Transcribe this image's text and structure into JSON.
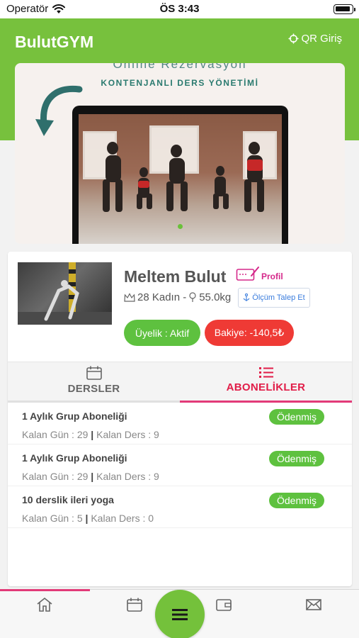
{
  "status_bar": {
    "carrier": "Operatör",
    "time": "ÖS 3:43"
  },
  "header": {
    "app_title": "BulutGYM",
    "qr_label": "QR Giriş"
  },
  "banner": {
    "title_partial": "Online Rezervasyon",
    "subtitle": "KONTENJANLI DERS YÖNETİMİ",
    "active_slide_color": "#6ac03a"
  },
  "profile": {
    "name": "Meltem Bulut",
    "profile_link": "Profil",
    "age_gender": "28 Kadın -",
    "weight": "55.0kg",
    "measure_button": "Ölçüm Talep Et",
    "membership_status": "Üyelik : Aktif",
    "balance": "Bakiye: -140,5₺"
  },
  "tabs": [
    {
      "label": "DERSLER",
      "icon": "calendar-icon",
      "active": false
    },
    {
      "label": "ABONELİKLER",
      "icon": "list-icon",
      "active": true
    }
  ],
  "subscriptions": [
    {
      "title": "1 Aylık Grup Aboneliği",
      "days_label": "Kalan Gün : 29",
      "sep": "|",
      "lessons_label": "Kalan Ders : 9",
      "status": "Ödenmiş"
    },
    {
      "title": "1 Aylık Grup Aboneliği",
      "days_label": "Kalan Gün : 29",
      "sep": "|",
      "lessons_label": "Kalan Ders : 9",
      "status": "Ödenmiş"
    },
    {
      "title": "10 derslik ileri yoga",
      "days_label": "Kalan Gün : 5",
      "sep": "|",
      "lessons_label": "Kalan Ders : 0",
      "status": "Ödenmiş"
    }
  ],
  "bottom_nav": [
    "home-icon",
    "calendar-icon",
    "menu-icon",
    "wallet-icon",
    "mail-icon"
  ],
  "colors": {
    "brand_green": "#77c13d",
    "accent_pink": "#e23a78",
    "danger_red": "#ef3a35",
    "success_green": "#5ec13f"
  }
}
